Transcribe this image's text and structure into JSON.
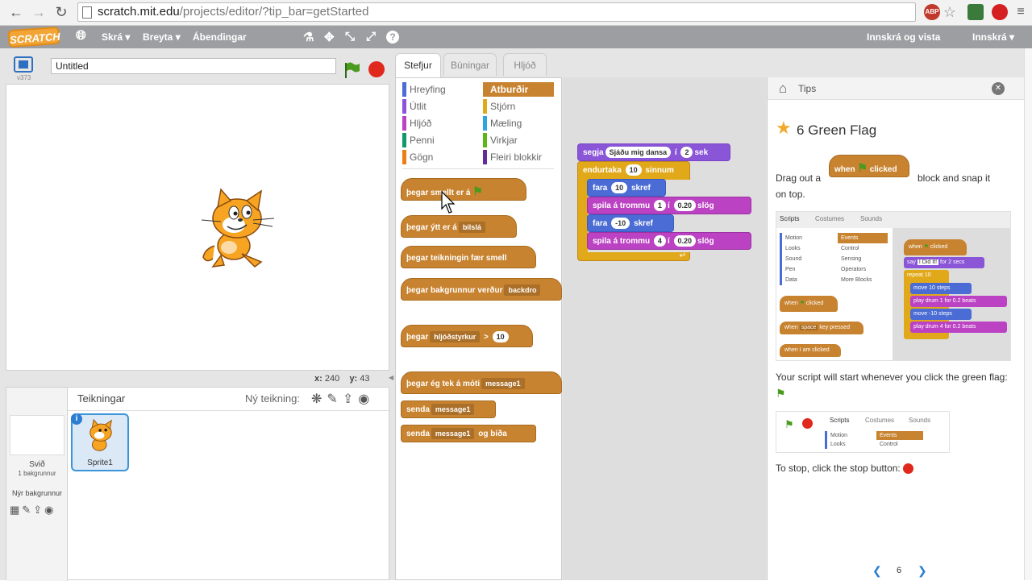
{
  "browser": {
    "url_host": "scratch.mit.edu",
    "url_path": "/projects/editor/?tip_bar=getStarted"
  },
  "menubar": {
    "logo": "SCRATCH",
    "file": "Skrá",
    "edit": "Breyta",
    "tips": "Ábendingar",
    "join": "Innskrá og vista",
    "signin": "Innskrá"
  },
  "stage": {
    "title_value": "Untitled",
    "version": "v373",
    "x_label": "x:",
    "x_value": "240",
    "y_label": "y:",
    "y_value": "43"
  },
  "sprites": {
    "header": "Teikningar",
    "new_sprite_label": "Ný teikning:",
    "stage_label": "Svið",
    "stage_count": "1 bakgrunnur",
    "new_backdrop": "Nýr bakgrunnur",
    "sprite1": "Sprite1"
  },
  "tabs": {
    "scripts": "Stefjur",
    "costumes": "Búningar",
    "sounds": "Hljóð"
  },
  "categories": {
    "motion": "Hreyfing",
    "looks": "Útlit",
    "sound": "Hljóð",
    "pen": "Penni",
    "data": "Gögn",
    "events": "Atburðir",
    "control": "Stjórn",
    "sensing": "Mæling",
    "operators": "Virkjar",
    "more": "Fleiri blokkir"
  },
  "palette_blocks": {
    "flag_text": "þegar smellt er á",
    "key_text": "þegar ýtt er á",
    "key_dd": "bilslá",
    "clicked_text": "þegar teikningin fær smell",
    "backdrop_text": "þegar bakgrunnur verður",
    "backdrop_dd": "backdro",
    "loudness_text": "þegar",
    "loudness_dd": "hljóðstyrkur",
    "loudness_op": ">",
    "loudness_val": "10",
    "receive_text": "þegar ég tek á móti",
    "receive_dd": "message1",
    "broadcast_text": "senda",
    "broadcast_dd": "message1",
    "broadcastwait_text": "senda",
    "broadcastwait_dd": "message1",
    "broadcastwait_tail": "og bíða"
  },
  "script": {
    "say_text": "segja",
    "say_value": "Sjáðu mig dansa",
    "say_for": "í",
    "say_secs_val": "2",
    "say_secs": "sek",
    "repeat_text": "endurtaka",
    "repeat_val": "10",
    "repeat_unit": "sinnum",
    "move1_text": "fara",
    "move1_val": "10",
    "move1_unit": "skref",
    "drum1_text": "spila á trommu",
    "drum1_val": "1",
    "drum1_for": "í",
    "drum1_beats": "0.20",
    "drum1_unit": "slög",
    "move2_text": "fara",
    "move2_val": "-10",
    "move2_unit": "skref",
    "drum2_text": "spila á trommu",
    "drum2_val": "4",
    "drum2_for": "í",
    "drum2_beats": "0.20",
    "drum2_unit": "slög"
  },
  "tips": {
    "header": "Tips",
    "title": "6 Green Flag",
    "drag_out": "Drag out a",
    "block_when": "when",
    "block_clicked": "clicked",
    "block_suffix": "block and snap it",
    "on_top": "on top.",
    "script_text": "Your script will start whenever you click the green flag:",
    "stop_text": "To stop, click the stop button:",
    "page": "6",
    "img1": {
      "tabs": [
        "Scripts",
        "Costumes",
        "Sounds"
      ],
      "cats_left": [
        "Motion",
        "Looks",
        "Sound",
        "Pen",
        "Data"
      ],
      "cats_right": [
        "Events",
        "Control",
        "Sensing",
        "Operators",
        "More Blocks"
      ],
      "when": "when",
      "clicked": "clicked",
      "key_when": "when",
      "key_dd": "space",
      "key_pressed": "key pressed",
      "iam_clicked": "when I am clicked",
      "say": "say",
      "say_val": "I Did It!",
      "say_for": "for",
      "say_secs_val": "2",
      "say_secs": "secs",
      "repeat": "repeat",
      "repeat_val": "10",
      "move": "move",
      "move_val": "10",
      "steps": "steps",
      "play_drum": "play drum",
      "drum1": "1",
      "drum_for": "for",
      "beats_val": "0.2",
      "beats": "beats",
      "move_val2": "-10",
      "drum2": "4"
    },
    "img2": {
      "tabs": [
        "Scripts",
        "Costumes",
        "Sounds"
      ],
      "cats_left": [
        "Motion",
        "Looks"
      ],
      "cats_right": [
        "Events",
        "Control"
      ]
    }
  },
  "colors": {
    "menubar": "#9c9ea1",
    "events": "#c88330",
    "motion": "#4a6cd4",
    "sound": "#bb42c3",
    "looks": "#8a55d7",
    "control": "#e1a91a",
    "pen": "#0e9a6c",
    "data": "#ee7d16",
    "sensing": "#2ca5e2",
    "operators": "#5cb712",
    "more": "#632d99",
    "flag": "#4a9a1e",
    "stop": "#e0281c"
  }
}
